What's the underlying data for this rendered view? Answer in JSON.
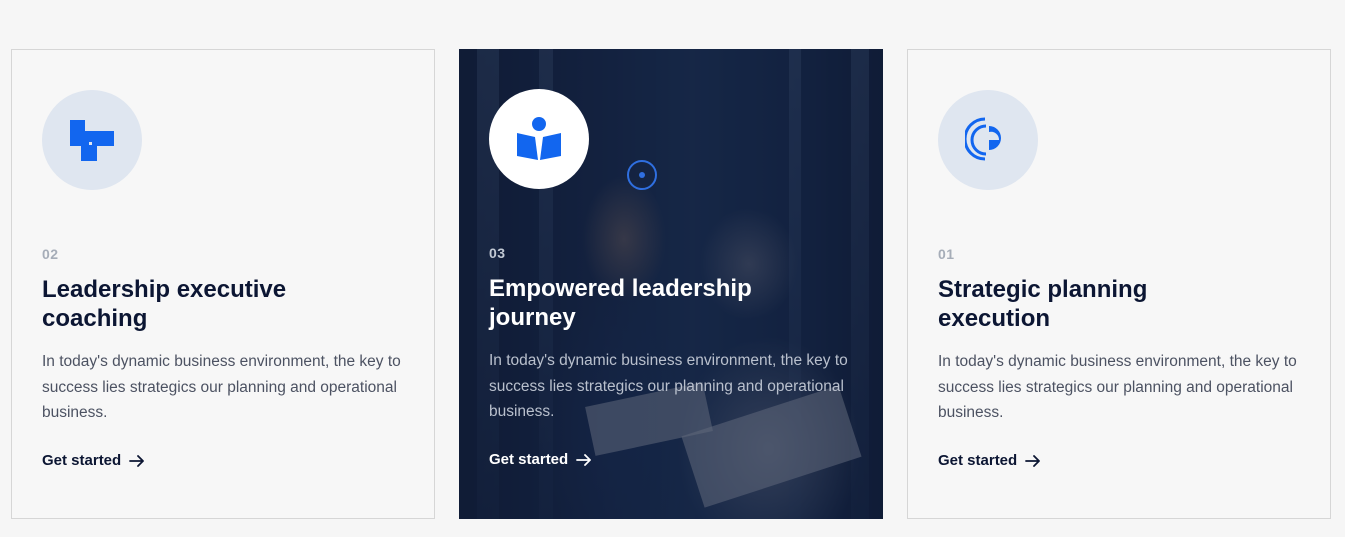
{
  "accent_color": "#1266ef",
  "cards": [
    {
      "number": "02",
      "title": "Leadership executive coaching",
      "description": "In today's dynamic business environment, the key to success lies strategics our planning and operational business.",
      "cta": "Get started",
      "icon": "blocks-icon"
    },
    {
      "number": "03",
      "title": "Empowered leadership journey",
      "description": "In today's dynamic business environment, the key to success lies strategics our planning and operational business.",
      "cta": "Get started",
      "icon": "person-book-icon",
      "background_image": "people-reviewing-documents-photo"
    },
    {
      "number": "01",
      "title": "Strategic planning execution",
      "description": "In today's dynamic business environment, the key to success lies strategics our planning and operational business.",
      "cta": "Get started",
      "icon": "signal-arc-icon"
    }
  ]
}
